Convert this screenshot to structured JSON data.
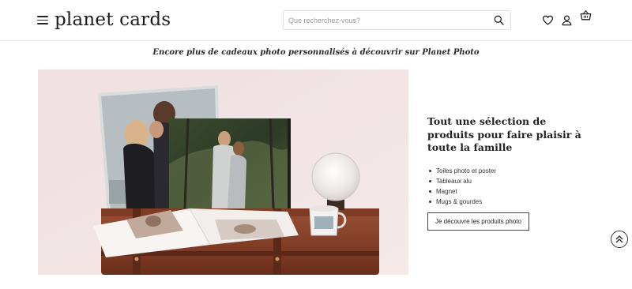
{
  "header": {
    "logo": "planet cards",
    "menu_icon": "hamburger-menu-icon",
    "search": {
      "placeholder": "Que recherchez-vous?",
      "value": "",
      "icon": "search-icon"
    },
    "icons": [
      "heart-icon",
      "user-icon",
      "basket-icon"
    ]
  },
  "banner": {
    "tagline": "Encore plus de cadeaux photo personnalisés à découvrir sur Planet Photo"
  },
  "hero": {
    "image": "photo-products-scene-image"
  },
  "info": {
    "title": "Tout une sélection de produits pour faire plaisir à toute la famille",
    "items": [
      "Toiles photo et poster",
      "Tableaux alu",
      "Magnet",
      "Mugs & gourdes"
    ],
    "cta_label": "Je découvre les produits photo"
  },
  "scroll_top": {
    "icon": "double-chevron-up-icon"
  },
  "colors": {
    "text": "#222222",
    "border": "#e6e6e6",
    "hero_bg": "#f0e3e4"
  }
}
